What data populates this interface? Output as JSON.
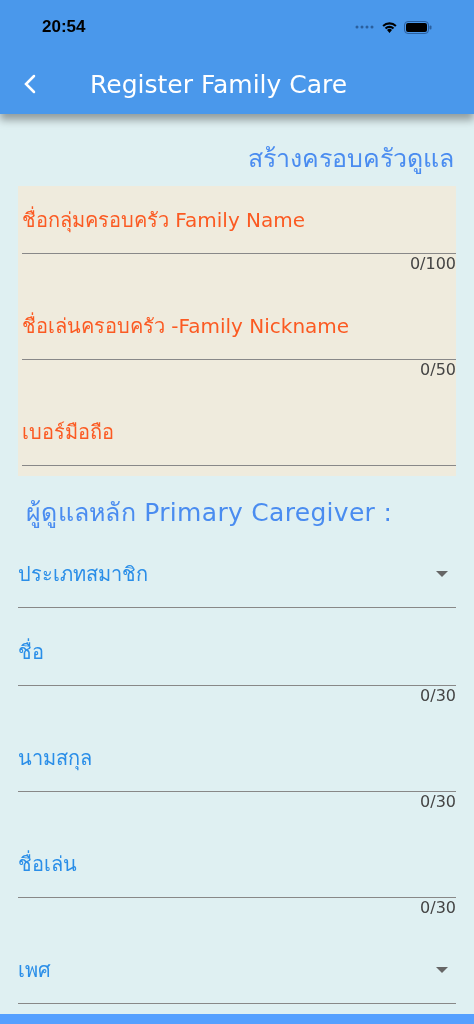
{
  "status_bar": {
    "time": "20:54"
  },
  "app_bar": {
    "title": "Register Family Care"
  },
  "family_section": {
    "heading": "สร้างครอบครัวดูแล",
    "fields": [
      {
        "kind": "text",
        "placeholder": "ชื่อกลุ่มครอบครัว Family Name",
        "counter": "0/100"
      },
      {
        "kind": "text",
        "placeholder": "ชื่อเล่นครอบครัว -Family Nickname",
        "counter": "0/50"
      },
      {
        "kind": "text",
        "placeholder": "เบอร์มือถือ"
      }
    ]
  },
  "caregiver_section": {
    "heading": "ผู้ดูแลหลัก Primary Caregiver :",
    "fields": [
      {
        "kind": "dropdown",
        "placeholder": "ประเภทสมาชิก"
      },
      {
        "kind": "text",
        "placeholder": "ชื่อ",
        "counter": "0/30"
      },
      {
        "kind": "text",
        "placeholder": "นามสกุล",
        "counter": "0/30"
      },
      {
        "kind": "text",
        "placeholder": "ชื่อเล่น",
        "counter": "0/30"
      },
      {
        "kind": "dropdown",
        "placeholder": "เพศ"
      }
    ]
  }
}
